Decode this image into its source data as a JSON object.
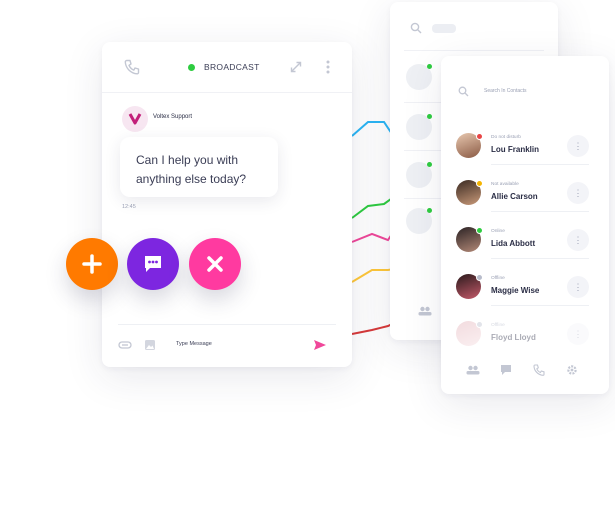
{
  "chat": {
    "header": {
      "status_label": "BROADCAST"
    },
    "agent": {
      "name": "Voltex Support",
      "initial": "V"
    },
    "message": {
      "text": "Can I help you with anything else today?",
      "time": "12:45"
    },
    "composer": {
      "placeholder": "Type Message"
    }
  },
  "fabs": [
    {
      "icon": "plus-icon",
      "color": "#ff7a00"
    },
    {
      "icon": "chat-bubble-icon",
      "color": "#7d26e0"
    },
    {
      "icon": "close-icon",
      "color": "#ff3aa0"
    }
  ],
  "contacts_panel": {
    "search_placeholder": "Search In Contacts",
    "contacts": [
      {
        "name": "Lou Franklin",
        "status": "Do not disturb",
        "status_color": "#e84545"
      },
      {
        "name": "Allie Carson",
        "status": "Not available",
        "status_color": "#f5b400"
      },
      {
        "name": "Lida Abbott",
        "status": "Online",
        "status_color": "#2ecc40"
      },
      {
        "name": "Maggie Wise",
        "status": "Offline",
        "status_color": "#b8bccb"
      },
      {
        "name": "Floyd Lloyd",
        "status": "Offline",
        "status_color": "#b8bccb"
      }
    ],
    "tabs": [
      "users-icon",
      "chat-icon",
      "phone-icon",
      "gear-icon"
    ]
  },
  "colors": {
    "blue": "#2bb6f5",
    "green": "#2ecc40",
    "pink": "#f0489a",
    "yellow": "#ffc83a",
    "red": "#d83a3a"
  }
}
